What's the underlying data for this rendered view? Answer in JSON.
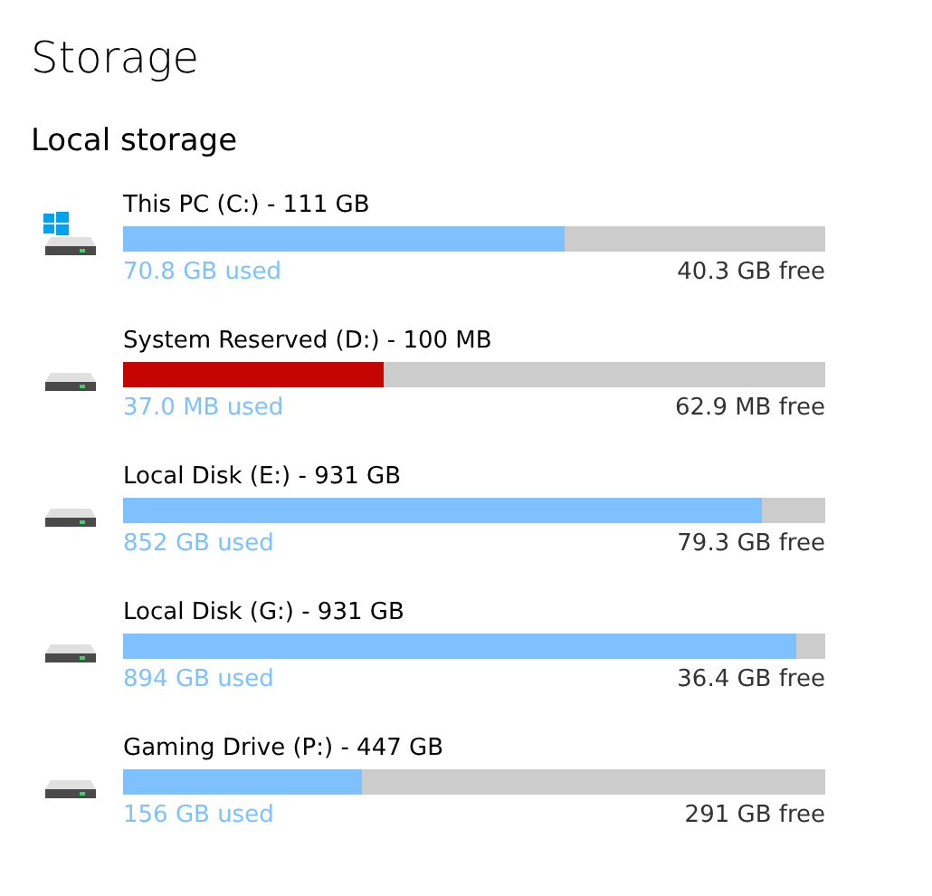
{
  "title": "Storage",
  "section": "Local storage",
  "drives": [
    {
      "kind": "system",
      "name": "This PC (C:) - 111 GB",
      "level": 0.63,
      "color": "#7fc1ff",
      "used": "70.8 GB used",
      "free": "40.3 GB free"
    },
    {
      "kind": "disk",
      "name": "System Reserved (D:) - 100 MB",
      "level": 0.37,
      "color": "#c50500",
      "used": "37.0 MB used",
      "free": "62.9 MB free"
    },
    {
      "kind": "disk",
      "name": "Local Disk (E:) - 931 GB",
      "level": 0.91,
      "color": "#7fc1ff",
      "used": "852 GB used",
      "free": "79.3 GB free"
    },
    {
      "kind": "disk",
      "name": "Local Disk (G:) - 931 GB",
      "level": 0.96,
      "color": "#7fc1ff",
      "used": "894 GB used",
      "free": "36.4 GB free"
    },
    {
      "kind": "disk",
      "name": "Gaming Drive (P:) - 447 GB",
      "level": 0.34,
      "color": "#7fc1ff",
      "used": "156 GB used",
      "free": "291 GB free"
    }
  ]
}
